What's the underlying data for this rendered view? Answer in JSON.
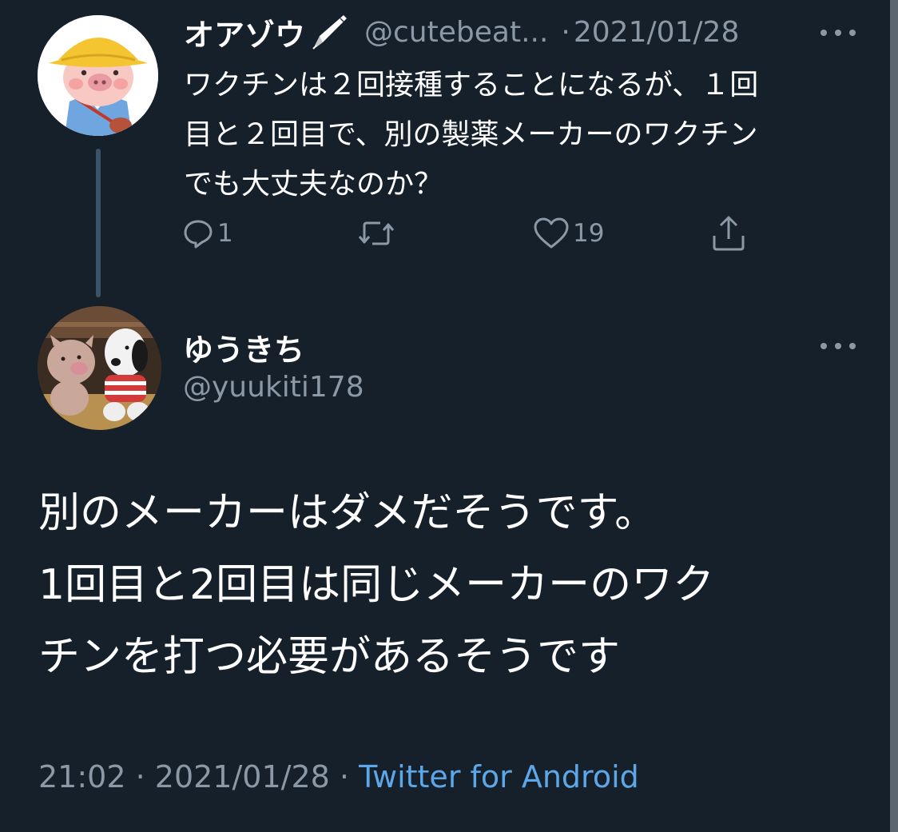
{
  "parent_tweet": {
    "display_name": "オアゾウ",
    "handle": "@cutebeat...",
    "separator": "·",
    "date": "2021/01/28",
    "body": "ワクチンは２回接種することになるが、１回\n目と２回目で、別の製薬メーカーのワクチン\nでも大丈夫なのか？",
    "reply_count": "1",
    "like_count": "19",
    "avatar": "pig-in-yellow-hat-avatar",
    "badge_icon": "fountain-pen-icon"
  },
  "main_tweet": {
    "display_name": "ゆうきち",
    "handle": "@yuukiti178",
    "body": "別のメーカーはダメだそうです。\n1回目と2回目は同じメーカーのワク\nチンを打つ必要があるそうです",
    "time": "21:02",
    "separator": "·",
    "date": "2021/01/28",
    "client": "Twitter for Android",
    "avatar": "plush-toys-avatar"
  },
  "colors": {
    "background": "#15202b",
    "text_primary": "#ffffff",
    "text_secondary": "#8b98a5",
    "link": "#5da7e8",
    "thread_line": "#3d5466"
  }
}
